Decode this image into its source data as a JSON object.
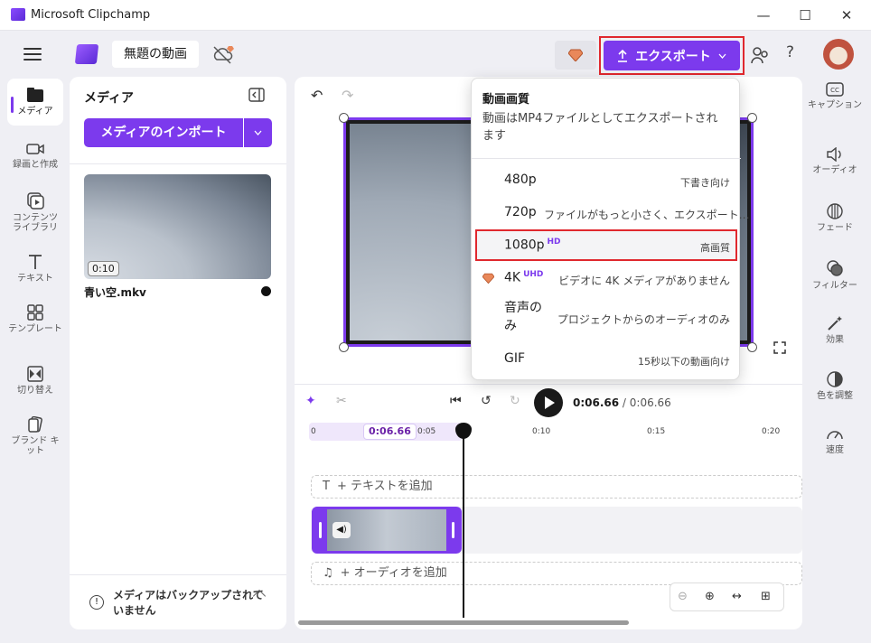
{
  "window": {
    "title": "Microsoft Clipchamp",
    "minimize": "—",
    "maximize": "☐",
    "close": "✕"
  },
  "header": {
    "project_name": "無題の動画",
    "export_label": "エクスポート",
    "help": "?"
  },
  "left_rail": [
    {
      "label": "メディア"
    },
    {
      "label": "録画と作成"
    },
    {
      "label": "コンテンツ ライブラリ"
    },
    {
      "label": "テキスト"
    },
    {
      "label": "テンプレート"
    },
    {
      "label": "切り替え"
    },
    {
      "label": "ブランド キット"
    }
  ],
  "media_panel": {
    "title": "メディア",
    "import_label": "メディアのインポート",
    "item": {
      "duration": "0:10",
      "filename": "青い空.mkv"
    },
    "backup_notice": "メディアはバックアップされていません"
  },
  "timeline": {
    "current": "0:06.66",
    "sep": " / ",
    "total": "0:06.66",
    "chip": "0:06.66",
    "ticks": [
      "0",
      "0:05",
      "0:10",
      "0:15",
      "0:20"
    ],
    "add_text": "+ テキストを追加",
    "add_audio": "+ オーディオを追加"
  },
  "right_rail": [
    {
      "label": "キャプション"
    },
    {
      "label": "オーディオ"
    },
    {
      "label": "フェード"
    },
    {
      "label": "フィルター"
    },
    {
      "label": "効果"
    },
    {
      "label": "色を調整"
    },
    {
      "label": "速度"
    }
  ],
  "export_menu": {
    "title": "動画画質",
    "description": "動画はMP4ファイルとしてエクスポートされます",
    "options": [
      {
        "label": "480p",
        "badge": "",
        "desc": "下書き向け"
      },
      {
        "label": "720p",
        "badge": "",
        "desc": "ファイルがもっと小さく、エクスポート…"
      },
      {
        "label": "1080p",
        "badge": "HD",
        "desc": "高画質",
        "selected": true
      },
      {
        "label": "4K",
        "badge": "UHD",
        "desc": "ビデオに 4K メディアがありません"
      },
      {
        "label": "音声のみ",
        "badge": "",
        "desc": "プロジェクトからのオーディオのみ"
      },
      {
        "label": "GIF",
        "badge": "",
        "desc": "15秒以下の動画向け"
      }
    ]
  },
  "colors": {
    "accent": "#7c3aed",
    "highlight": "#e0282e"
  }
}
